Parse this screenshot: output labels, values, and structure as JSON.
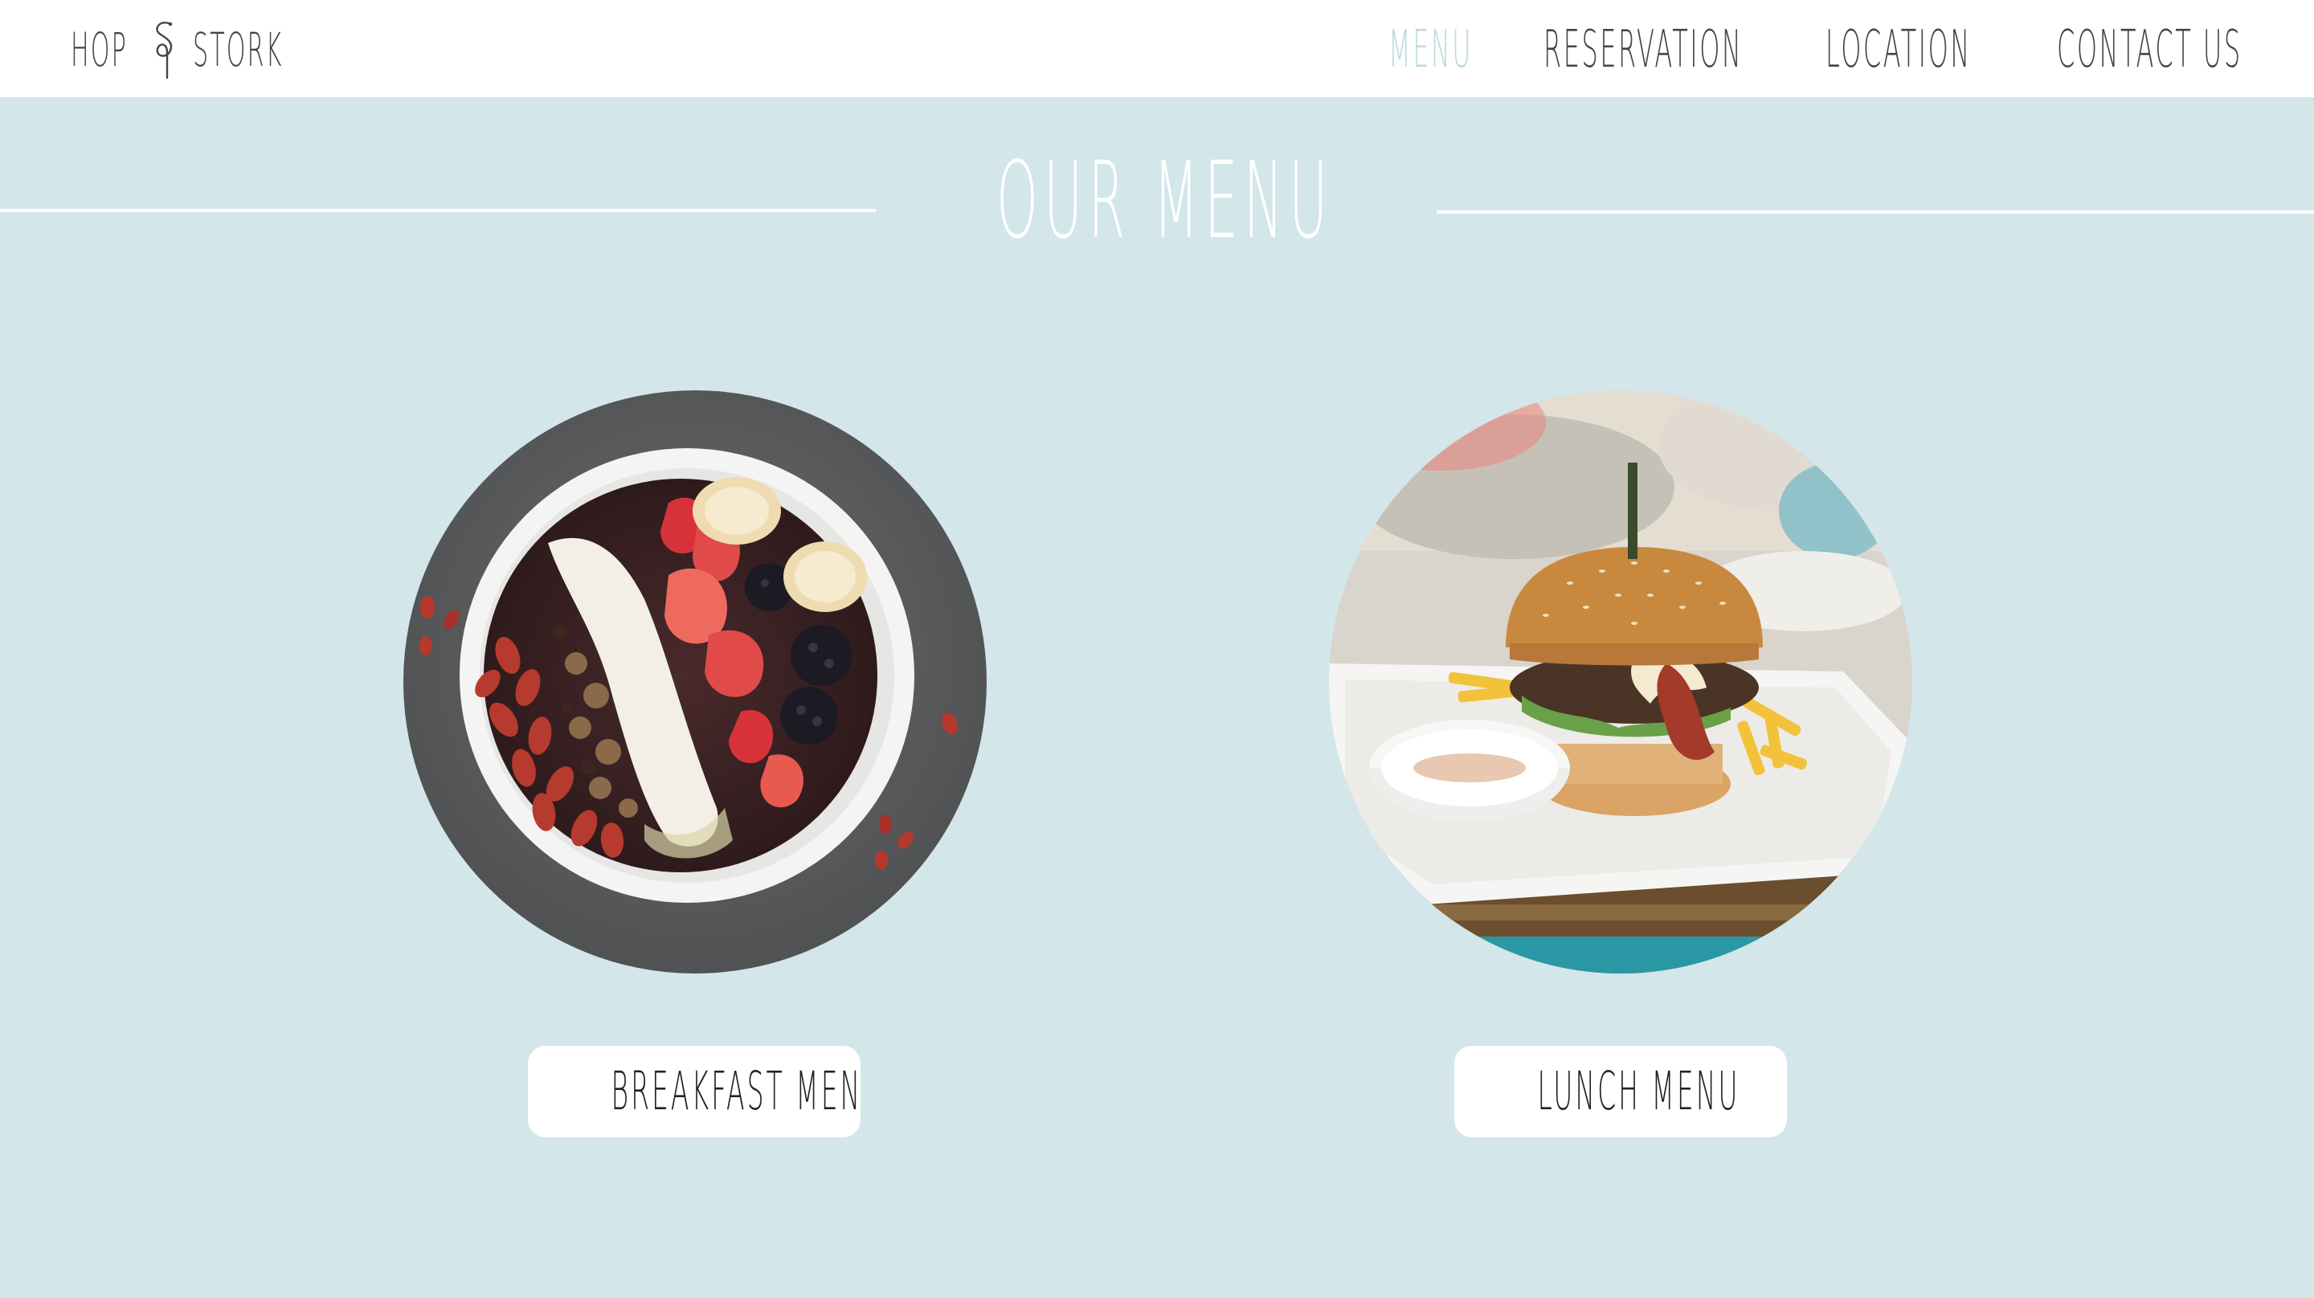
{
  "header": {
    "logo": {
      "left": "HOP",
      "right": "STORK",
      "mark_icon": "stork-glyph-icon"
    },
    "nav": [
      {
        "label": "MENU",
        "active": true
      },
      {
        "label": "RESERVATION",
        "active": false
      },
      {
        "label": "LOCATION",
        "active": false
      },
      {
        "label": "CONTACT US",
        "active": false
      }
    ]
  },
  "main": {
    "title": "OUR MENU",
    "cards": [
      {
        "image_icon": "acai-bowl-photo",
        "button_label": "BREAKFAST MENU"
      },
      {
        "image_icon": "burger-plate-photo",
        "button_label": "LUNCH MENU"
      }
    ]
  },
  "colors": {
    "background": "#d3e6ea",
    "header": "#ffffff",
    "active_nav": "#bcd9df",
    "text": "#444444",
    "title": "#ffffff"
  }
}
